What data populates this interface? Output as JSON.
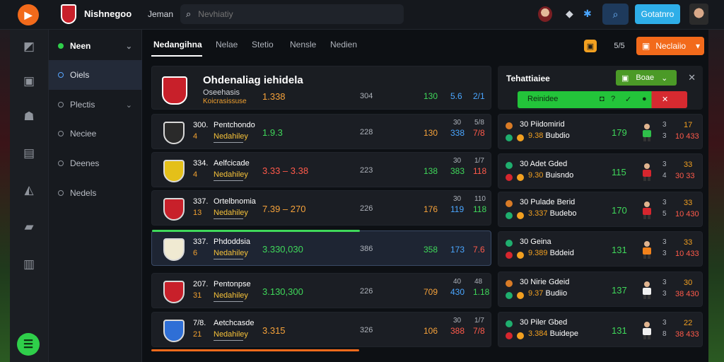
{
  "topbar": {
    "app_title": "Nishnegoo",
    "nav_label": "Jeman",
    "search_placeholder": "Nevhiatiy",
    "cta_label": "Gotatnro"
  },
  "sidebar": {
    "items": [
      {
        "label": "Neen",
        "state": "header"
      },
      {
        "label": "Oiels",
        "state": "active"
      },
      {
        "label": "Plectis",
        "state": "normal"
      },
      {
        "label": "Neciee",
        "state": "normal"
      },
      {
        "label": "Deenes",
        "state": "normal"
      },
      {
        "label": "Nedels",
        "state": "normal"
      }
    ]
  },
  "tabs": [
    "Nedangihna",
    "Nelae",
    "Stetio",
    "Nensle",
    "Nedien"
  ],
  "filter_button": "Neclaiio",
  "tool_label": "5/5",
  "matches": {
    "header": {
      "title": "Ohdenaliag iehidela",
      "subtitle": "Oseehasis",
      "sub2": "Koicrasissuse",
      "odds": "1.338",
      "mid": "304",
      "v1": "130",
      "v2": "5.6",
      "v3": "2/1"
    },
    "rows": [
      {
        "num": "300.",
        "team": "Pentchondo",
        "sub": "4",
        "league": "Nedahiley",
        "odds": "1.9.3",
        "mid": "228",
        "v1": "130",
        "v2": "338",
        "v3": "7/8",
        "s1": "30",
        "s2": "5/8",
        "colors": [
          "orange",
          "green",
          "blue",
          "red"
        ],
        "crest": "#2a2a2a"
      },
      {
        "num": "334.",
        "team": "Aelfcicade",
        "sub": "4",
        "league": "Nedahiley",
        "odds": "3.33 – 3.38",
        "mid": "223",
        "v1": "138",
        "v2": "383",
        "v3": "118",
        "s1": "30",
        "s2": "1/7",
        "colors": [
          "green",
          "red",
          "green",
          "red"
        ],
        "crest": "#e4c019"
      },
      {
        "num": "337.",
        "team": "Ortelbnomia",
        "sub": "13",
        "league": "Nedahiley",
        "odds": "7.39 – 270",
        "mid": "226",
        "v1": "176",
        "v2": "119",
        "v3": "118",
        "s1": "30",
        "s2": "110",
        "colors": [
          "orange",
          "orange",
          "blue",
          "green"
        ],
        "crest": "#c8202a"
      },
      {
        "num": "337.",
        "team": "Phdoddsia",
        "sub": "6",
        "league": "Nedahiley",
        "odds": "3.330,030",
        "mid": "386",
        "v1": "358",
        "v2": "173",
        "v3": "7.6",
        "s1": "",
        "s2": "",
        "colors": [
          "green",
          "green",
          "blue",
          "red"
        ],
        "crest": "#f0ead2"
      },
      {
        "num": "207.",
        "team": "Pentonpse",
        "sub": "31",
        "league": "Nedahiley",
        "odds": "3.130,300",
        "mid": "226",
        "v1": "709",
        "v2": "430",
        "v3": "1.18",
        "s1": "40",
        "s2": "48",
        "colors": [
          "orange",
          "green",
          "blue",
          "green"
        ],
        "crest": "#c8202a"
      },
      {
        "num": "7/8.",
        "team": "Aetchcasde",
        "sub": "21",
        "league": "Nedahiley",
        "odds": "3.315",
        "mid": "326",
        "v1": "106",
        "v2": "388",
        "v3": "7/8",
        "s1": "30",
        "s2": "1/7",
        "colors": [
          "orange",
          "orange",
          "red",
          "red"
        ],
        "crest": "#2f6fd6"
      }
    ]
  },
  "right_panel": {
    "title": "Tehattiaiee",
    "dropdown": "Boae",
    "bar_label": "Reinidee",
    "bets": [
      {
        "name": "30 Piidomirid",
        "num": "9.38",
        "info": "Bubdio",
        "odds": "179",
        "s1": "3",
        "s2": "3",
        "r1": "17",
        "r2": "10 433",
        "player": "green"
      },
      {
        "name": "30 Adet Gded",
        "num": "9.30",
        "info": "Buisndo",
        "odds": "115",
        "s1": "3",
        "s2": "4",
        "r1": "33",
        "r2": "30 33",
        "player": "red"
      },
      {
        "name": "30 Pulade Berid",
        "num": "3.337",
        "info": "Budebo",
        "odds": "170",
        "s1": "3",
        "s2": "5",
        "r1": "33",
        "r2": "10 430",
        "player": "red"
      },
      {
        "name": "30 Geina",
        "num": "9.389",
        "info": "Bddeid",
        "odds": "131",
        "s1": "3",
        "s2": "3",
        "r1": "33",
        "r2": "10 433",
        "player": "orange"
      },
      {
        "name": "30 Nirie Gdeid",
        "num": "9.37",
        "info": "Budiio",
        "odds": "137",
        "s1": "3",
        "s2": "3",
        "r1": "30",
        "r2": "38 430",
        "player": "white"
      },
      {
        "name": "30 Piler Gbed",
        "num": "3.384",
        "info": "Buidepe",
        "odds": "131",
        "s1": "3",
        "s2": "8",
        "r1": "22",
        "r2": "38 433",
        "player": "white"
      }
    ]
  }
}
